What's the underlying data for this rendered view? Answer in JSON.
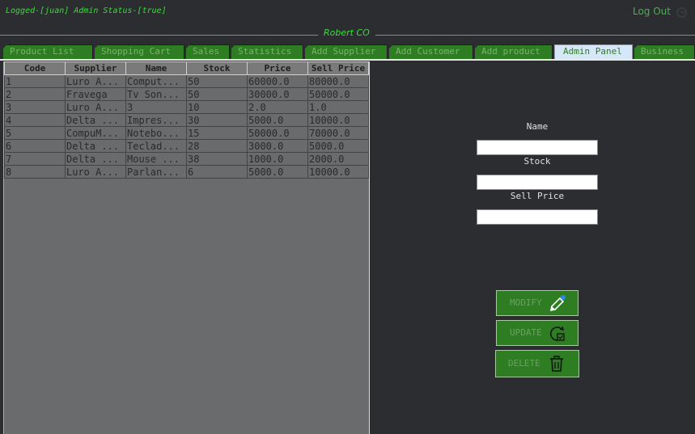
{
  "header": {
    "status_text": "Logged-[juan] Admin Status-[true]",
    "logout_label": "Log Out",
    "brand": "Robert CO"
  },
  "tabs": [
    {
      "label": "Product  List",
      "active": false
    },
    {
      "label": "Shopping Cart",
      "active": false
    },
    {
      "label": "Sales",
      "active": false
    },
    {
      "label": "Statistics",
      "active": false
    },
    {
      "label": "Add Supplier",
      "active": false
    },
    {
      "label": "Add Customer",
      "active": false
    },
    {
      "label": "Add product",
      "active": false
    },
    {
      "label": "Admin Panel",
      "active": true
    },
    {
      "label": "Business",
      "active": false
    }
  ],
  "table": {
    "columns": [
      "Code",
      "Supplier",
      "Name",
      "Stock",
      "Price",
      "Sell Price"
    ],
    "rows": [
      [
        "1",
        "Luro A...",
        "Comput...",
        "50",
        "60000.0",
        "80000.0"
      ],
      [
        "2",
        "Fravega",
        "Tv Son...",
        "50",
        "30000.0",
        "50000.0"
      ],
      [
        "3",
        "Luro A...",
        "3",
        "10",
        "2.0",
        "1.0"
      ],
      [
        "4",
        "Delta ...",
        "Impres...",
        "30",
        "5000.0",
        "10000.0"
      ],
      [
        "5",
        "CompuM...",
        "Notebo...",
        "15",
        "50000.0",
        "70000.0"
      ],
      [
        "6",
        "Delta ...",
        "Teclad...",
        "28",
        "3000.0",
        "5000.0"
      ],
      [
        "7",
        "Delta ...",
        "Mouse ...",
        "38",
        "1000.0",
        "2000.0"
      ],
      [
        "8",
        "Luro A...",
        "Parlan...",
        "6",
        "5000.0",
        "10000.0"
      ]
    ]
  },
  "form": {
    "name_label": "Name",
    "name_value": "",
    "stock_label": "Stock",
    "stock_value": "",
    "sell_price_label": "Sell Price",
    "sell_price_value": ""
  },
  "buttons": {
    "modify": "MODIFY",
    "update": "UPDATE",
    "delete": "DELETE"
  },
  "colors": {
    "accent_green": "#2e7d23",
    "status_green": "#3ddc3d",
    "background": "#2b2d30",
    "table_bg": "#6a6b6d"
  }
}
